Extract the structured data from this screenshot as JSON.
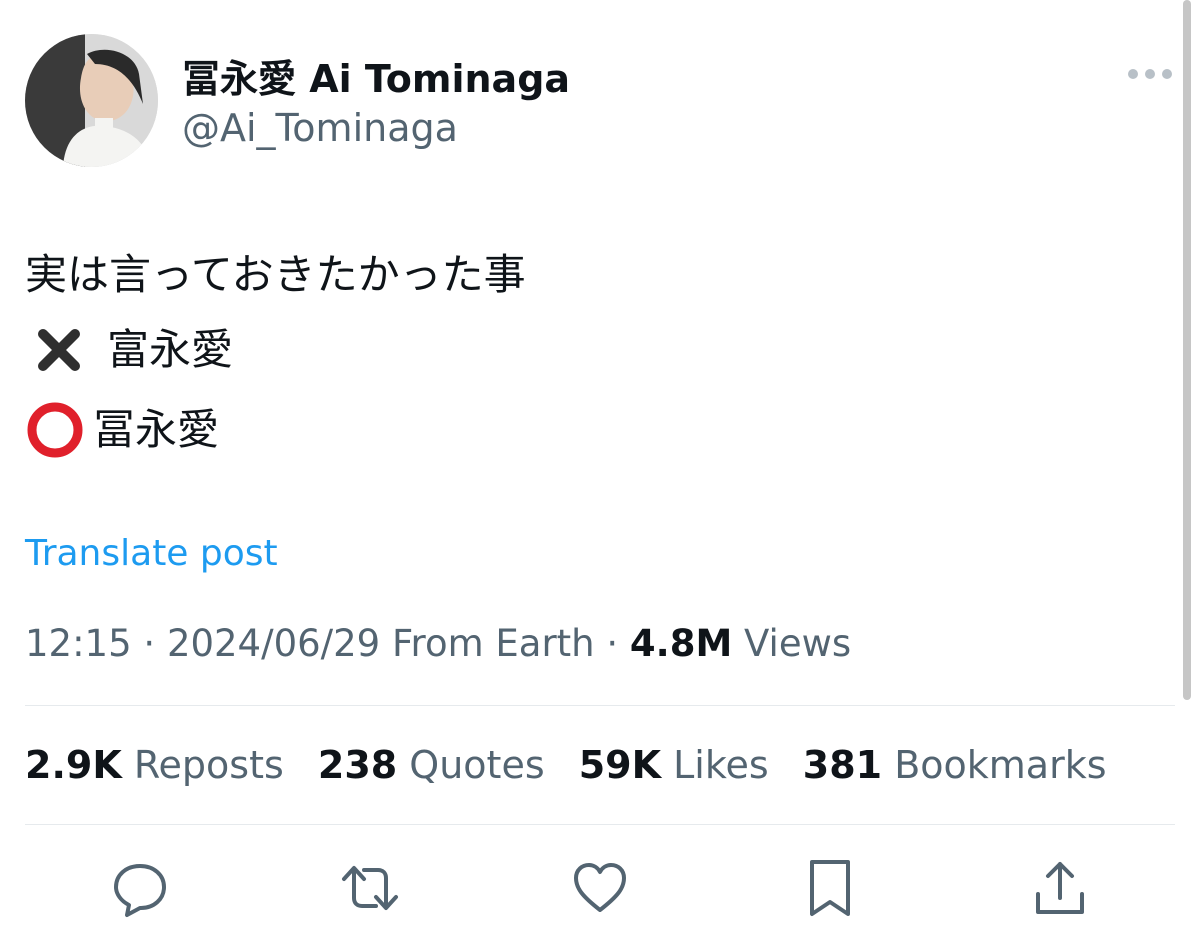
{
  "author": {
    "display_name": "冨永愛 Ai Tominaga",
    "handle": "@Ai_Tominaga"
  },
  "tweet": {
    "line1": "実は言っておきたかった事",
    "line2_mark": "cross-mark-icon",
    "line2_text": "富永愛",
    "line3_mark": "circle-mark-icon",
    "line3_text": "冨永愛"
  },
  "translate_label": "Translate post",
  "meta": {
    "time": "12:15",
    "separator1": " · ",
    "date": "2024/06/29",
    "source": " From Earth",
    "separator2": " · ",
    "views_count": "4.8M",
    "views_label": " Views"
  },
  "stats": {
    "reposts_count": "2.9K",
    "reposts_label": " Reposts",
    "quotes_count": "238",
    "quotes_label": " Quotes",
    "likes_count": "59K",
    "likes_label": " Likes",
    "bookmarks_count": "381",
    "bookmarks_label": " Bookmarks"
  },
  "icons": {
    "more": "more-horizontal-icon",
    "reply": "reply-icon",
    "repost": "repost-icon",
    "like": "heart-icon",
    "bookmark": "bookmark-icon",
    "share": "share-icon"
  },
  "colors": {
    "accent": "#1d9bf0",
    "text_primary": "#0f1419",
    "text_secondary": "#536471",
    "cross_mark": "#2f2f2f",
    "circle_mark": "#e0202b"
  }
}
